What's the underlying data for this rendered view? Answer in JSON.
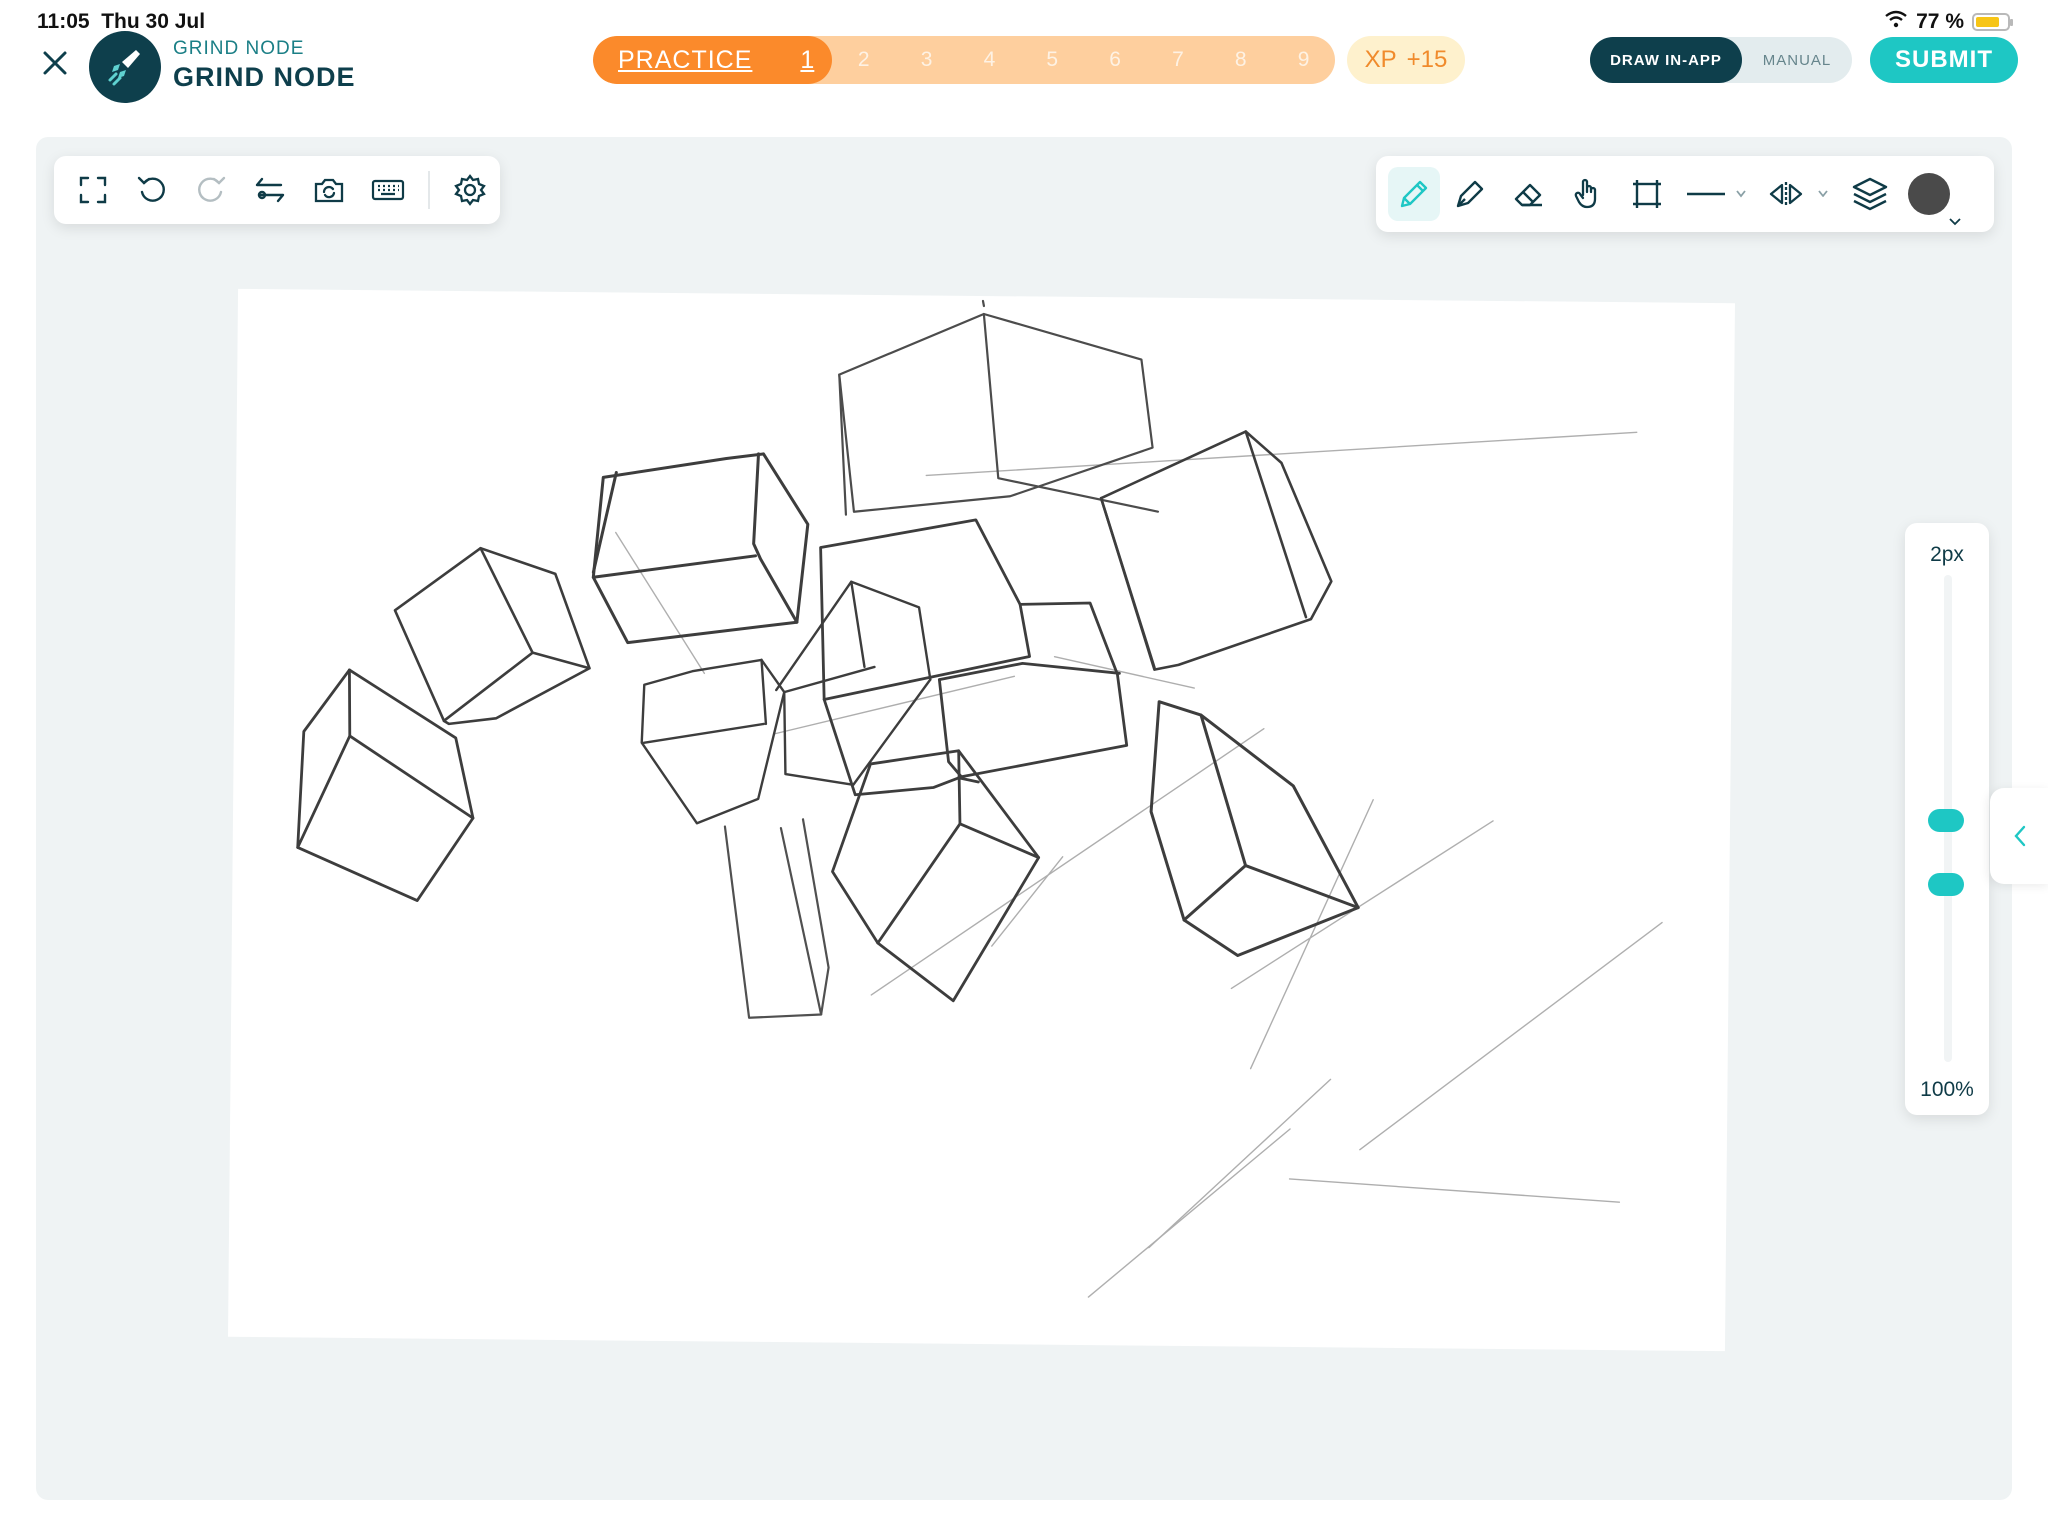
{
  "status": {
    "time": "11:05",
    "date": "Thu 30 Jul",
    "battery": "77 %",
    "battery_level": 0.77,
    "battery_color": "#f7c516"
  },
  "header": {
    "brand_small": "GRIND NODE",
    "brand_big": "GRIND NODE",
    "progress": {
      "label": "PRACTICE",
      "current": "1",
      "steps": [
        "2",
        "3",
        "4",
        "5",
        "6",
        "7",
        "8",
        "9"
      ]
    },
    "xp": {
      "label": "XP",
      "value": "+15"
    },
    "mode": {
      "active": "DRAW IN-APP",
      "inactive": "MANUAL"
    },
    "submit": "SUBMIT"
  },
  "toolbar_left": [
    "fullscreen-icon",
    "undo-icon",
    "redo-icon",
    "swap-icon",
    "camera-icon",
    "keyboard-icon",
    "settings-icon"
  ],
  "toolbar_right": [
    "pencil-icon",
    "pen-icon",
    "eraser-icon",
    "hand-icon",
    "crop-icon",
    "line-style-icon",
    "mirror-icon",
    "layers-icon",
    "color-swatch"
  ],
  "side_panel": {
    "size": "2px",
    "opacity": "100%",
    "size_level": 0.5,
    "opacity_level": 1.0
  },
  "colors": {
    "accent": "#1ec7c4",
    "brand_dark": "#0e3f4c",
    "progress_active": "#fb8a2b",
    "progress_track": "#fecf9e",
    "brush_color": "#4a4a4a"
  }
}
